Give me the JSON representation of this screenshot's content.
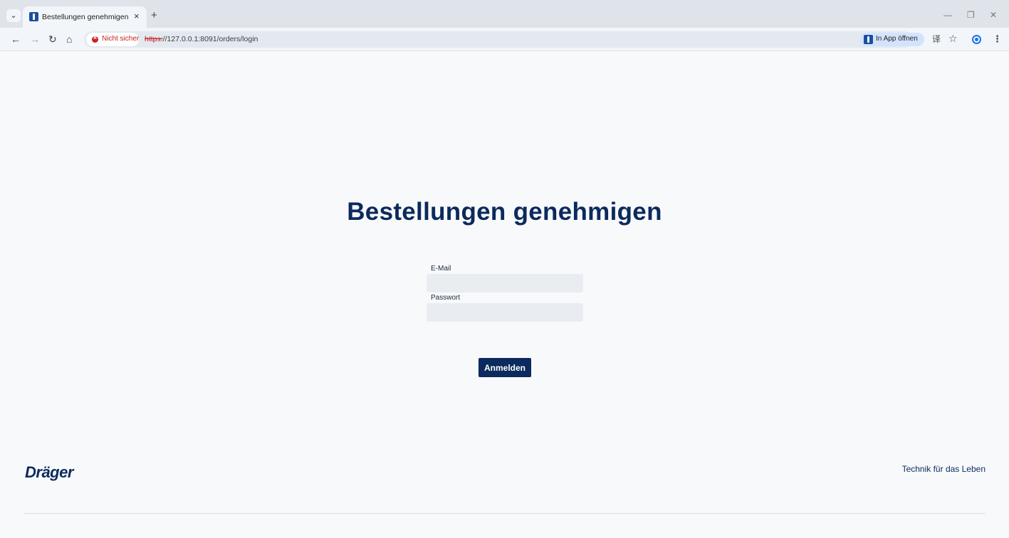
{
  "browser": {
    "tab": {
      "title": "Bestellungen genehmigen",
      "close_glyph": "×"
    },
    "newtab_glyph": "+",
    "tab_search_glyph": "⌄",
    "window": {
      "minimize": "—",
      "restore": "❐",
      "close": "✕"
    },
    "nav": {
      "back": "←",
      "forward": "→",
      "reload": "↻",
      "home": "⌂"
    },
    "security_chip": {
      "text": "Nicht sicher"
    },
    "url": {
      "scheme": "https:",
      "rest": "//127.0.0.1:8091/orders/login"
    },
    "open_in_app": {
      "label": "In App öffnen"
    },
    "icons": {
      "translate": "译",
      "star": "☆",
      "menu": "⋮"
    }
  },
  "page": {
    "title": "Bestellungen genehmigen",
    "form": {
      "email": {
        "label": "E-Mail",
        "value": "",
        "placeholder": ""
      },
      "password": {
        "label": "Passwort",
        "value": "",
        "placeholder": ""
      },
      "submit_label": "Anmelden"
    },
    "footer": {
      "logo_text": "Dräger",
      "slogan": "Technik für das Leben"
    }
  },
  "colors": {
    "brand_navy": "#0b2a5e",
    "page_bg": "#f8f9fa",
    "input_bg": "#e9edf2",
    "insecure_red": "#c5221f"
  }
}
